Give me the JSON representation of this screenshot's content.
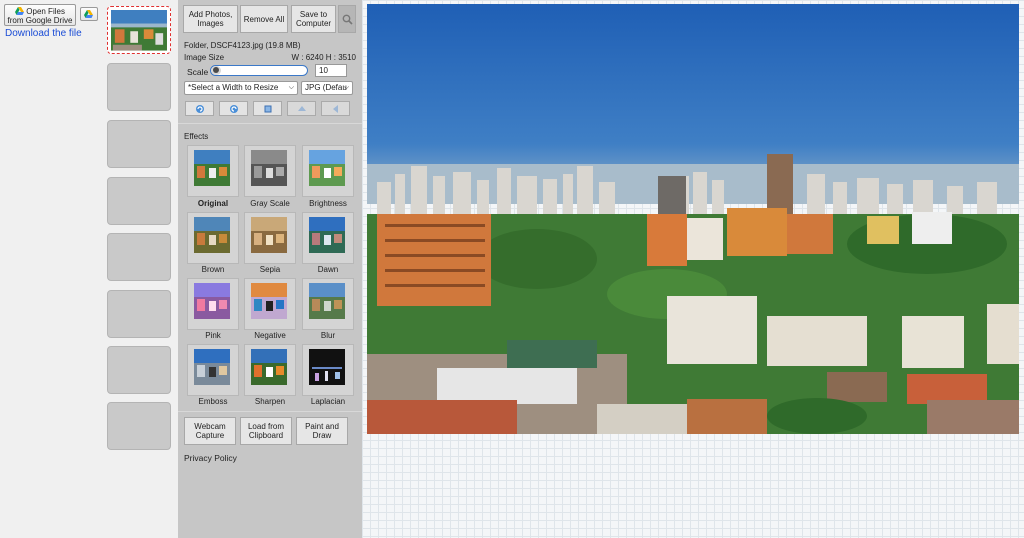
{
  "left": {
    "open_files_line1": "Open Files",
    "open_files_line2": "from Google Drive",
    "download_link": "Download the file",
    "icons": [
      "google-drive-icon"
    ]
  },
  "toolbar": {
    "add_photos": "Add Photos,\nImages",
    "remove_all": "Remove All",
    "save": "Save to\nComputer",
    "search_icon": "magnifier-icon"
  },
  "file": {
    "info": "Folder,  DSCF4123.jpg (19.8 MB)",
    "size_label": "Image Size",
    "size_value": "W : 6240 H : 3510"
  },
  "scale": {
    "label": "Scale",
    "value": "10",
    "level_percent": 10
  },
  "resize": {
    "width_select": "*Select a Width to Resize",
    "format_select": "JPG (Defau"
  },
  "tools": [
    "rotate-right-icon",
    "rotate-left-icon",
    "crop-icon",
    "flip-vertical-icon",
    "flip-horizontal-icon"
  ],
  "effects": {
    "title": "Effects",
    "items": [
      {
        "label": "Original",
        "active": true
      },
      {
        "label": "Gray Scale"
      },
      {
        "label": "Brightness"
      },
      {
        "label": "Brown"
      },
      {
        "label": "Sepia"
      },
      {
        "label": "Dawn"
      },
      {
        "label": "Pink"
      },
      {
        "label": "Negative"
      },
      {
        "label": "Blur"
      },
      {
        "label": "Emboss"
      },
      {
        "label": "Sharpen"
      },
      {
        "label": "Laplacian"
      }
    ]
  },
  "bottom": {
    "webcam": "Webcam\nCapture",
    "clipboard": "Load from\nClipboard",
    "paint": "Paint and\nDraw",
    "privacy": "Privacy Policy"
  },
  "colors": {
    "accent_blue": "#1a4cd6",
    "slider_border": "#3b78c8",
    "thumb_active_border": "#e03030"
  }
}
